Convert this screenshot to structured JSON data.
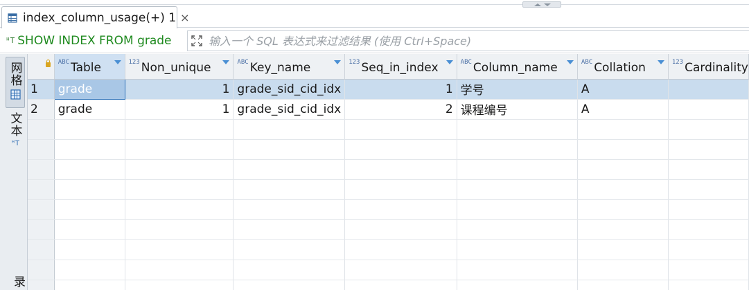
{
  "tab": {
    "title": "index_column_usage(+) 1",
    "close_glyph": "×",
    "icon": "table-icon"
  },
  "query": {
    "sql_icon_text": "ᴴT",
    "text": "SHOW INDEX FROM grade"
  },
  "filter": {
    "placeholder": "输入一个 SQL 表达式来过滤结果 (使用 Ctrl+Space)"
  },
  "side": {
    "grid_label": "网格",
    "text_label": "文本",
    "record_label": "录"
  },
  "columns": [
    {
      "type": "ABC",
      "name": "Table"
    },
    {
      "type": "123",
      "name": "Non_unique"
    },
    {
      "type": "ABC",
      "name": "Key_name"
    },
    {
      "type": "123",
      "name": "Seq_in_index"
    },
    {
      "type": "ABC",
      "name": "Column_name"
    },
    {
      "type": "ABC",
      "name": "Collation"
    },
    {
      "type": "123",
      "name": "Cardinality"
    }
  ],
  "rows": [
    {
      "num": "1",
      "table": "grade",
      "non_unique": "1",
      "key_name": "grade_sid_cid_idx",
      "seq": "1",
      "column_name": "学号",
      "collation": "A",
      "cardinality": ""
    },
    {
      "num": "2",
      "table": "grade",
      "non_unique": "1",
      "key_name": "grade_sid_cid_idx",
      "seq": "2",
      "column_name": "课程编号",
      "collation": "A",
      "cardinality": ""
    }
  ],
  "colors": {
    "query_green": "#1f8a1f",
    "selection": "#c9dcee",
    "header_bg": "#eef1f4"
  }
}
